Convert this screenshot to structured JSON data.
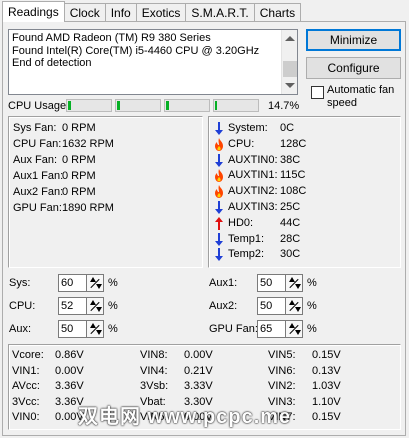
{
  "tabs": [
    "Readings",
    "Clock",
    "Info",
    "Exotics",
    "S.M.A.R.T.",
    "Charts"
  ],
  "active_tab": "Readings",
  "log_lines": [
    "Found AMD Radeon (TM) R9 380 Series",
    "Found Intel(R) Core(TM) i5-4460 CPU @ 3.20GHz",
    "End of detection"
  ],
  "buttons": {
    "minimize": "Minimize",
    "configure": "Configure"
  },
  "auto_fan": {
    "label": "Automatic fan speed",
    "checked": false
  },
  "cpu_usage": {
    "label": "CPU Usage",
    "percent_text": "14.7%",
    "core_levels": [
      0.07,
      0.06,
      0.06,
      0.05
    ]
  },
  "fans": [
    {
      "name": "Sys Fan:",
      "value": "0 RPM"
    },
    {
      "name": "CPU Fan:",
      "value": "1632 RPM"
    },
    {
      "name": "Aux Fan:",
      "value": "0 RPM"
    },
    {
      "name": "Aux1 Fan:",
      "value": "0 RPM"
    },
    {
      "name": "Aux2 Fan:",
      "value": "0 RPM"
    },
    {
      "name": "GPU Fan:",
      "value": "1890 RPM"
    }
  ],
  "temps": [
    {
      "name": "System:",
      "value": "0C",
      "icon": "arrow-down-icon"
    },
    {
      "name": "CPU:",
      "value": "128C",
      "icon": "flame-icon"
    },
    {
      "name": "AUXTIN0:",
      "value": "38C",
      "icon": "arrow-down-icon"
    },
    {
      "name": "AUXTIN1:",
      "value": "115C",
      "icon": "flame-icon"
    },
    {
      "name": "AUXTIN2:",
      "value": "108C",
      "icon": "flame-icon"
    },
    {
      "name": "AUXTIN3:",
      "value": "25C",
      "icon": "arrow-down-icon"
    },
    {
      "name": "HD0:",
      "value": "44C",
      "icon": "arrow-up-icon"
    },
    {
      "name": "Temp1:",
      "value": "28C",
      "icon": "arrow-down-icon"
    },
    {
      "name": "Temp2:",
      "value": "30C",
      "icon": "arrow-down-icon"
    }
  ],
  "fan_controls": {
    "sys": {
      "label": "Sys:",
      "value": "60"
    },
    "cpu": {
      "label": "CPU:",
      "value": "52"
    },
    "aux": {
      "label": "Aux:",
      "value": "50"
    },
    "aux1": {
      "label": "Aux1:",
      "value": "50"
    },
    "aux2": {
      "label": "Aux2:",
      "value": "50"
    },
    "gpu": {
      "label": "GPU Fan:",
      "value": "65"
    },
    "unit": "%"
  },
  "voltages": [
    [
      {
        "name": "Vcore:",
        "value": "0.86V"
      },
      {
        "name": "VIN1:",
        "value": "0.00V"
      },
      {
        "name": "AVcc:",
        "value": "3.36V"
      },
      {
        "name": "3Vcc:",
        "value": "3.36V"
      },
      {
        "name": "VIN0:",
        "value": "0.00V"
      }
    ],
    [
      {
        "name": "VIN8:",
        "value": "0.00V"
      },
      {
        "name": "VIN4:",
        "value": "0.21V"
      },
      {
        "name": "3Vsb:",
        "value": "3.33V"
      },
      {
        "name": "Vbat:",
        "value": "3.30V"
      },
      {
        "name": "VIN5:",
        "value": "0.00V"
      }
    ],
    [
      {
        "name": "VIN5:",
        "value": "0.15V"
      },
      {
        "name": "VIN6:",
        "value": "0.13V"
      },
      {
        "name": "VIN2:",
        "value": "1.03V"
      },
      {
        "name": "VIN3:",
        "value": "1.10V"
      },
      {
        "name": "VIN7:",
        "value": "0.15V"
      }
    ]
  ],
  "watermark": "双电网 www.pcpc.me",
  "colors": {
    "fill": "#06b025",
    "flame": "#ff4500",
    "arrow_down": "#1f3fd6",
    "arrow_up": "#e01010"
  }
}
